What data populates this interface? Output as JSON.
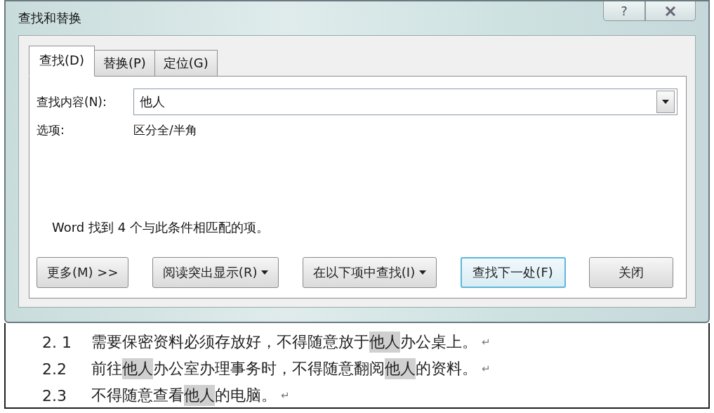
{
  "window": {
    "title": "查找和替换",
    "help": "?"
  },
  "tabs": [
    {
      "label": "查找(D)",
      "selected": true
    },
    {
      "label": "替换(P)",
      "selected": false
    },
    {
      "label": "定位(G)",
      "selected": false
    }
  ],
  "find_field": {
    "label": "查找内容(N):",
    "value": "他人"
  },
  "options": {
    "label": "选项:",
    "value": "区分全/半角"
  },
  "message": "Word 找到 4 个与此条件相匹配的项。",
  "buttons": [
    {
      "label": "更多(M) >>",
      "dropdown": false,
      "default": false
    },
    {
      "label": "阅读突出显示(R)",
      "dropdown": true,
      "default": false
    },
    {
      "label": "在以下项中查找(I)",
      "dropdown": true,
      "default": false
    },
    {
      "label": "查找下一处(F)",
      "dropdown": false,
      "default": true
    },
    {
      "label": "关闭",
      "dropdown": false,
      "default": false
    }
  ],
  "document": [
    {
      "number": "2. 1",
      "segments": [
        {
          "text": "需要保密资料必须存放好，不得随意放于",
          "highlighted": false
        },
        {
          "text": "他人",
          "highlighted": true
        },
        {
          "text": "办公桌上。",
          "highlighted": false
        }
      ],
      "mark": "↵"
    },
    {
      "number": "2.2",
      "segments": [
        {
          "text": "前往",
          "highlighted": false
        },
        {
          "text": "他人",
          "highlighted": true
        },
        {
          "text": "办公室办理事务时，不得随意翻阅",
          "highlighted": false
        },
        {
          "text": "他人",
          "highlighted": true
        },
        {
          "text": "的资料。",
          "highlighted": false
        }
      ],
      "mark": "↵"
    },
    {
      "number": "2.3",
      "segments": [
        {
          "text": "不得随意查看",
          "highlighted": false
        },
        {
          "text": "他人",
          "highlighted": true
        },
        {
          "text": "的电脑。",
          "highlighted": false
        }
      ],
      "mark": "↵"
    }
  ]
}
